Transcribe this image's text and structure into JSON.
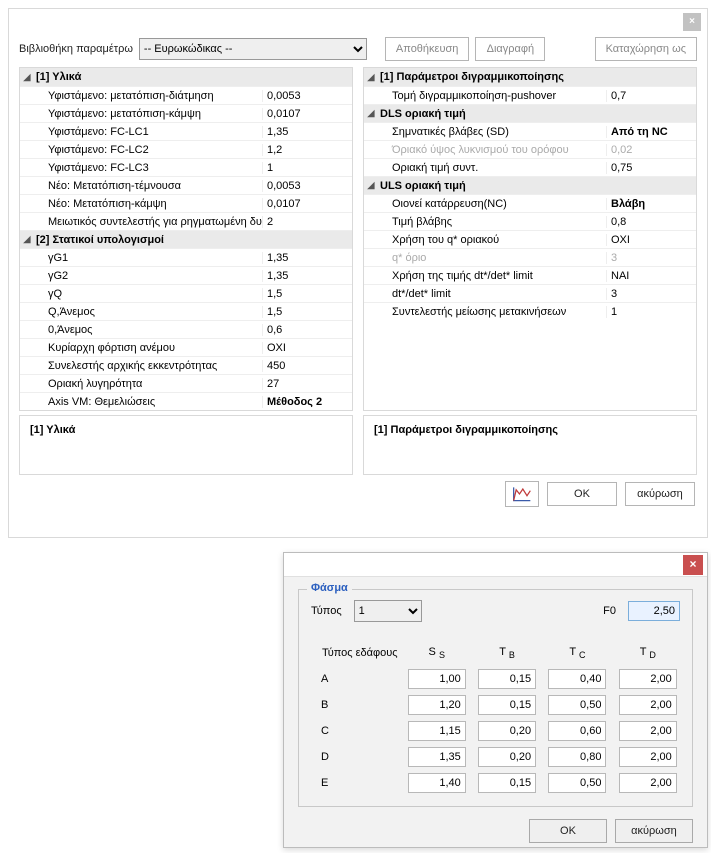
{
  "top": {
    "lib_label": "Βιβλιοθήκη παραμέτρω",
    "lib_value": "-- Ευρωκώδικας --",
    "save": "Αποθήκευση",
    "delete": "Διαγραφή",
    "saveas": "Καταχώρηση ως"
  },
  "left": {
    "g1": "[1] Υλικά",
    "r1l": "Υφιστάμενο: μετατόπιση-διάτμηση",
    "r1v": "0,0053",
    "r2l": "Υφιστάμενο: μετατόπιση-κάμψη",
    "r2v": "0,0107",
    "r3l": "Υφιστάμενο: FC-LC1",
    "r3v": "1,35",
    "r4l": "Υφιστάμενο: FC-LC2",
    "r4v": "1,2",
    "r5l": "Υφιστάμενο: FC-LC3",
    "r5v": "1",
    "r6l": "Νέο: Μετατόπιση-τέμνουσα",
    "r6v": "0,0053",
    "r7l": "Νέο: Μετατόπιση-κάμψη",
    "r7v": "0,0107",
    "r8l": "Μειωτικός συντελεστής για ρηγματωμένη δυ",
    "r8v": "2",
    "g2": "[2] Στατικοί υπολογισμοί",
    "s1l": "γG1",
    "s1v": "1,35",
    "s2l": "γG2",
    "s2v": "1,35",
    "s3l": "γQ",
    "s3v": "1,5",
    "s4l": "Q,Άνεμος",
    "s4v": "1,5",
    "s5l": "0,Άνεμος",
    "s5v": "0,6",
    "s6l": "Κυρίαρχη φόρτιση ανέμου",
    "s6v": "ΟΧΙ",
    "s7l": "Συνελεστής αρχικής εκκεντρότητας",
    "s7v": "450",
    "s8l": "Οριακή λυγηρότητα",
    "s8v": "27",
    "s9l": "Axis VM: Θεμελιώσεις",
    "s9v": "Μέθοδος 2"
  },
  "right": {
    "g1": "[1] Παράμετροι διγραμμικοποίησης",
    "a1l": "Τομή διγραμμικοποίηση-pushover",
    "a1v": "0,7",
    "g2": "DLS οριακή τιμή",
    "b1l": "Σημνατικές βλάβες (SD)",
    "b1v": "Από τη NC",
    "b2l": "Όριακό ύψος λυκνισμού του ορόφου",
    "b2v": "0,02",
    "b3l": "Οριακή τιμή συντ.",
    "b3v": "0,75",
    "g3": "ULS οριακή τιμή",
    "c1l": "Οιονεί κατάρρευση(NC)",
    "c1v": "Βλάβη",
    "c2l": "Τιμή βλάβης",
    "c2v": "0,8",
    "c3l": "Χρήση του q* οριακού",
    "c3v": "ΟΧΙ",
    "c4l": "q* όριο",
    "c4v": "3",
    "c5l": "Χρήση της τιμής dt*/det* limit",
    "c5v": "ΝΑΙ",
    "c6l": "dt*/det* limit",
    "c6v": "3",
    "c7l": "Συντελεστής μείωσης μετακινήσεων",
    "c7v": "1"
  },
  "desc": {
    "left": "[1] Υλικά",
    "right": "[1] Παράμετροι διγραμμικοποίησης"
  },
  "bot": {
    "ok": "OK",
    "cancel": "ακύρωση"
  },
  "spec": {
    "title": "Φάσμα",
    "type_label": "Τύπος",
    "type_value": "1",
    "f0_label": "F0",
    "f0_value": "2,50",
    "soil_label": "Τύπος εδάφους",
    "hS": "S",
    "hTB": "T",
    "hTBs": "B",
    "hTC": "T",
    "hTCs": "C",
    "hTD": "T",
    "hTDs": "D",
    "rows": [
      {
        "k": "A",
        "s": "1,00",
        "tb": "0,15",
        "tc": "0,40",
        "td": "2,00"
      },
      {
        "k": "B",
        "s": "1,20",
        "tb": "0,15",
        "tc": "0,50",
        "td": "2,00"
      },
      {
        "k": "C",
        "s": "1,15",
        "tb": "0,20",
        "tc": "0,60",
        "td": "2,00"
      },
      {
        "k": "D",
        "s": "1,35",
        "tb": "0,20",
        "tc": "0,80",
        "td": "2,00"
      },
      {
        "k": "E",
        "s": "1,40",
        "tb": "0,15",
        "tc": "0,50",
        "td": "2,00"
      }
    ],
    "ok": "OK",
    "cancel": "ακύρωση"
  }
}
